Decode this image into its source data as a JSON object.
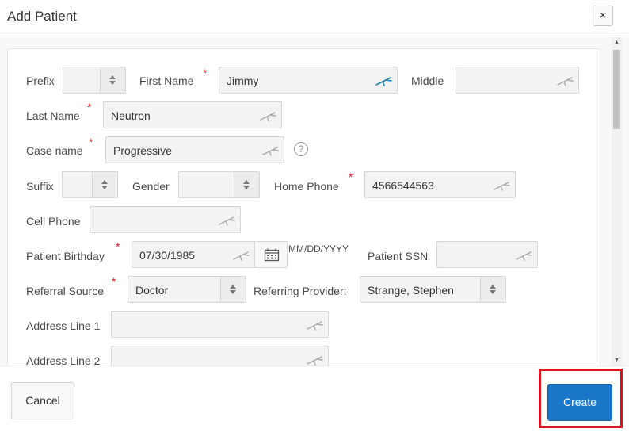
{
  "dialog": {
    "title": "Add Patient",
    "close_symbol": "×",
    "cancel_label": "Cancel",
    "create_label": "Create"
  },
  "fields": {
    "prefix": {
      "label": "Prefix",
      "value": ""
    },
    "first_name": {
      "label": "First Name",
      "value": "Jimmy"
    },
    "middle": {
      "label": "Middle",
      "value": ""
    },
    "last_name": {
      "label": "Last Name",
      "value": "Neutron"
    },
    "case_name": {
      "label": "Case name",
      "value": "Progressive",
      "help_symbol": "?"
    },
    "suffix": {
      "label": "Suffix",
      "value": ""
    },
    "gender": {
      "label": "Gender",
      "value": ""
    },
    "home_phone": {
      "label": "Home Phone",
      "value": "4566544563"
    },
    "cell_phone": {
      "label": "Cell Phone",
      "value": ""
    },
    "patient_birthday": {
      "label": "Patient Birthday",
      "value": "07/30/1985",
      "format_hint": "MM/DD/YYYY"
    },
    "patient_ssn": {
      "label": "Patient SSN",
      "value": ""
    },
    "referral_source": {
      "label": "Referral Source",
      "value": "Doctor"
    },
    "referring_provider": {
      "label": "Referring Provider:",
      "value": "Strange, Stephen"
    },
    "address_line_1": {
      "label": "Address Line 1",
      "value": ""
    },
    "address_line_2": {
      "label": "Address Line 2",
      "value": ""
    }
  },
  "required_marker": "*",
  "icons": {
    "field_tool": "pen-icon",
    "calendar": "calendar-icon",
    "help": "help-icon"
  },
  "colors": {
    "accent": "#1a76c8",
    "required": "#e02020",
    "highlight_box": "#e0121f",
    "active_tool_icon": "#1b7fa8"
  }
}
